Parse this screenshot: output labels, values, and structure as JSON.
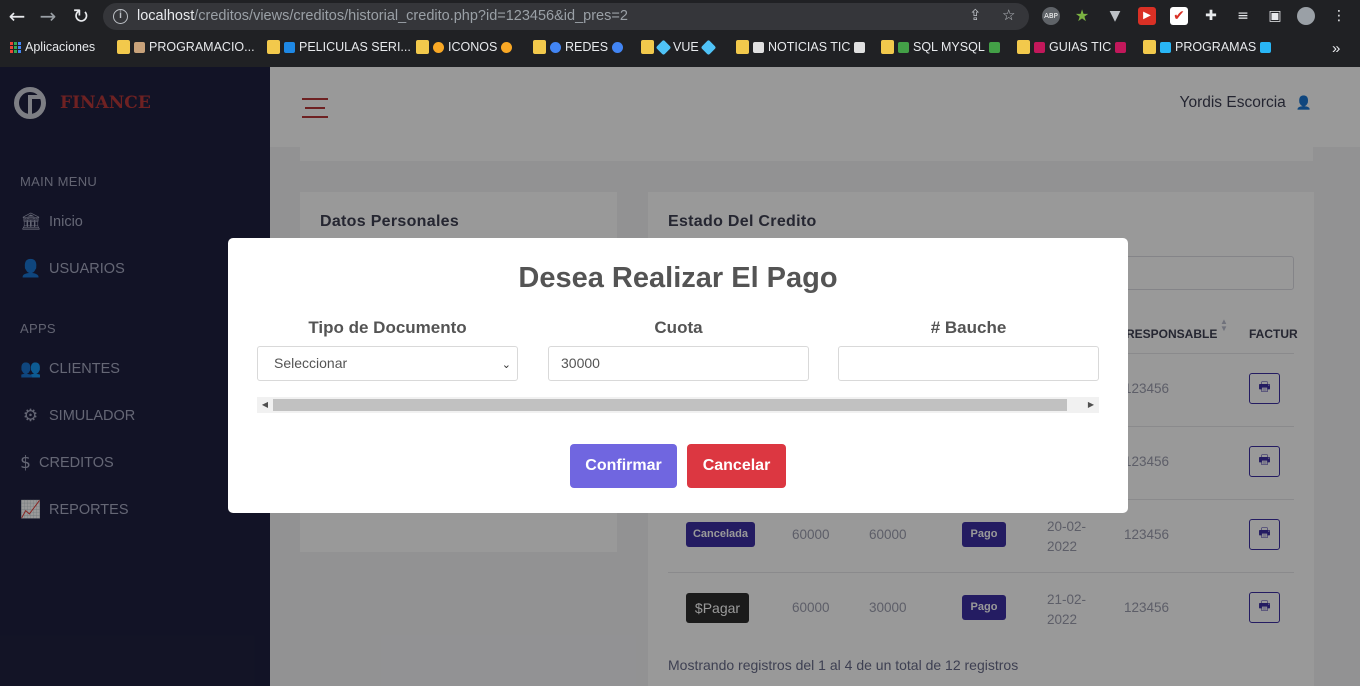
{
  "browser": {
    "url_host": "localhost",
    "url_path": "/creditos/views/creditos/historial_credito.php?id=123456&id_pres=2",
    "ext_abp": "ABP",
    "bookmarks": [
      {
        "label": "Aplicaciones"
      },
      {
        "label": "PROGRAMACIO..."
      },
      {
        "label": "PELICULAS SERI..."
      },
      {
        "label": "ICONOS"
      },
      {
        "label": "REDES"
      },
      {
        "label": "VUE"
      },
      {
        "label": "NOTICIAS TIC"
      },
      {
        "label": "SQL MYSQL"
      },
      {
        "label": "GUIAS TIC"
      },
      {
        "label": "PROGRAMAS"
      }
    ],
    "more": "»"
  },
  "sidebar": {
    "brand": "FINANCE",
    "main_menu_heading": "MAIN MENU",
    "apps_heading": "APPS",
    "items": [
      {
        "label": "Inicio",
        "icon": "bank-icon"
      },
      {
        "label": "USUARIOS",
        "icon": "user-icon"
      },
      {
        "label": "CLIENTES",
        "icon": "users-icon"
      },
      {
        "label": "SIMULADOR",
        "icon": "gears-icon"
      },
      {
        "label": "CREDITOS",
        "icon": "dollar-icon"
      },
      {
        "label": "REPORTES",
        "icon": "chart-line-icon"
      }
    ]
  },
  "header": {
    "user_name": "Yordis Escorcia"
  },
  "cards": {
    "personal_title": "Datos Personales",
    "credit_title": "Estado Del Credito"
  },
  "table": {
    "col_responsable": "RESPONSABLE",
    "col_factura": "FACTUR",
    "rows": [
      {
        "responsable": "123456"
      },
      {
        "responsable": "123456"
      },
      {
        "estado": "Cancelada",
        "valor": "60000",
        "cuota": "60000",
        "tipo": "Pago",
        "fecha": "20-02-2022",
        "responsable": "123456"
      },
      {
        "estado": "$Pagar",
        "valor": "60000",
        "cuota": "30000",
        "tipo": "Pago",
        "fecha": "21-02-2022",
        "responsable": "123456"
      }
    ],
    "footer": "Mostrando registros del 1 al 4 de un total de 12 registros"
  },
  "modal": {
    "title": "Desea Realizar El Pago",
    "tipo_label": "Tipo de Documento",
    "tipo_value": "Seleccionar",
    "cuota_label": "Cuota",
    "cuota_value": "30000",
    "bauche_label": "# Bauche",
    "bauche_value": "",
    "confirm": "Confirmar",
    "cancel": "Cancelar"
  },
  "colors": {
    "sidebar_bg": "#1f2140",
    "brand_red": "#b7383a",
    "badge_purple": "#3c2fa3",
    "confirm_btn": "#7066e0",
    "cancel_btn": "#dc3741"
  }
}
